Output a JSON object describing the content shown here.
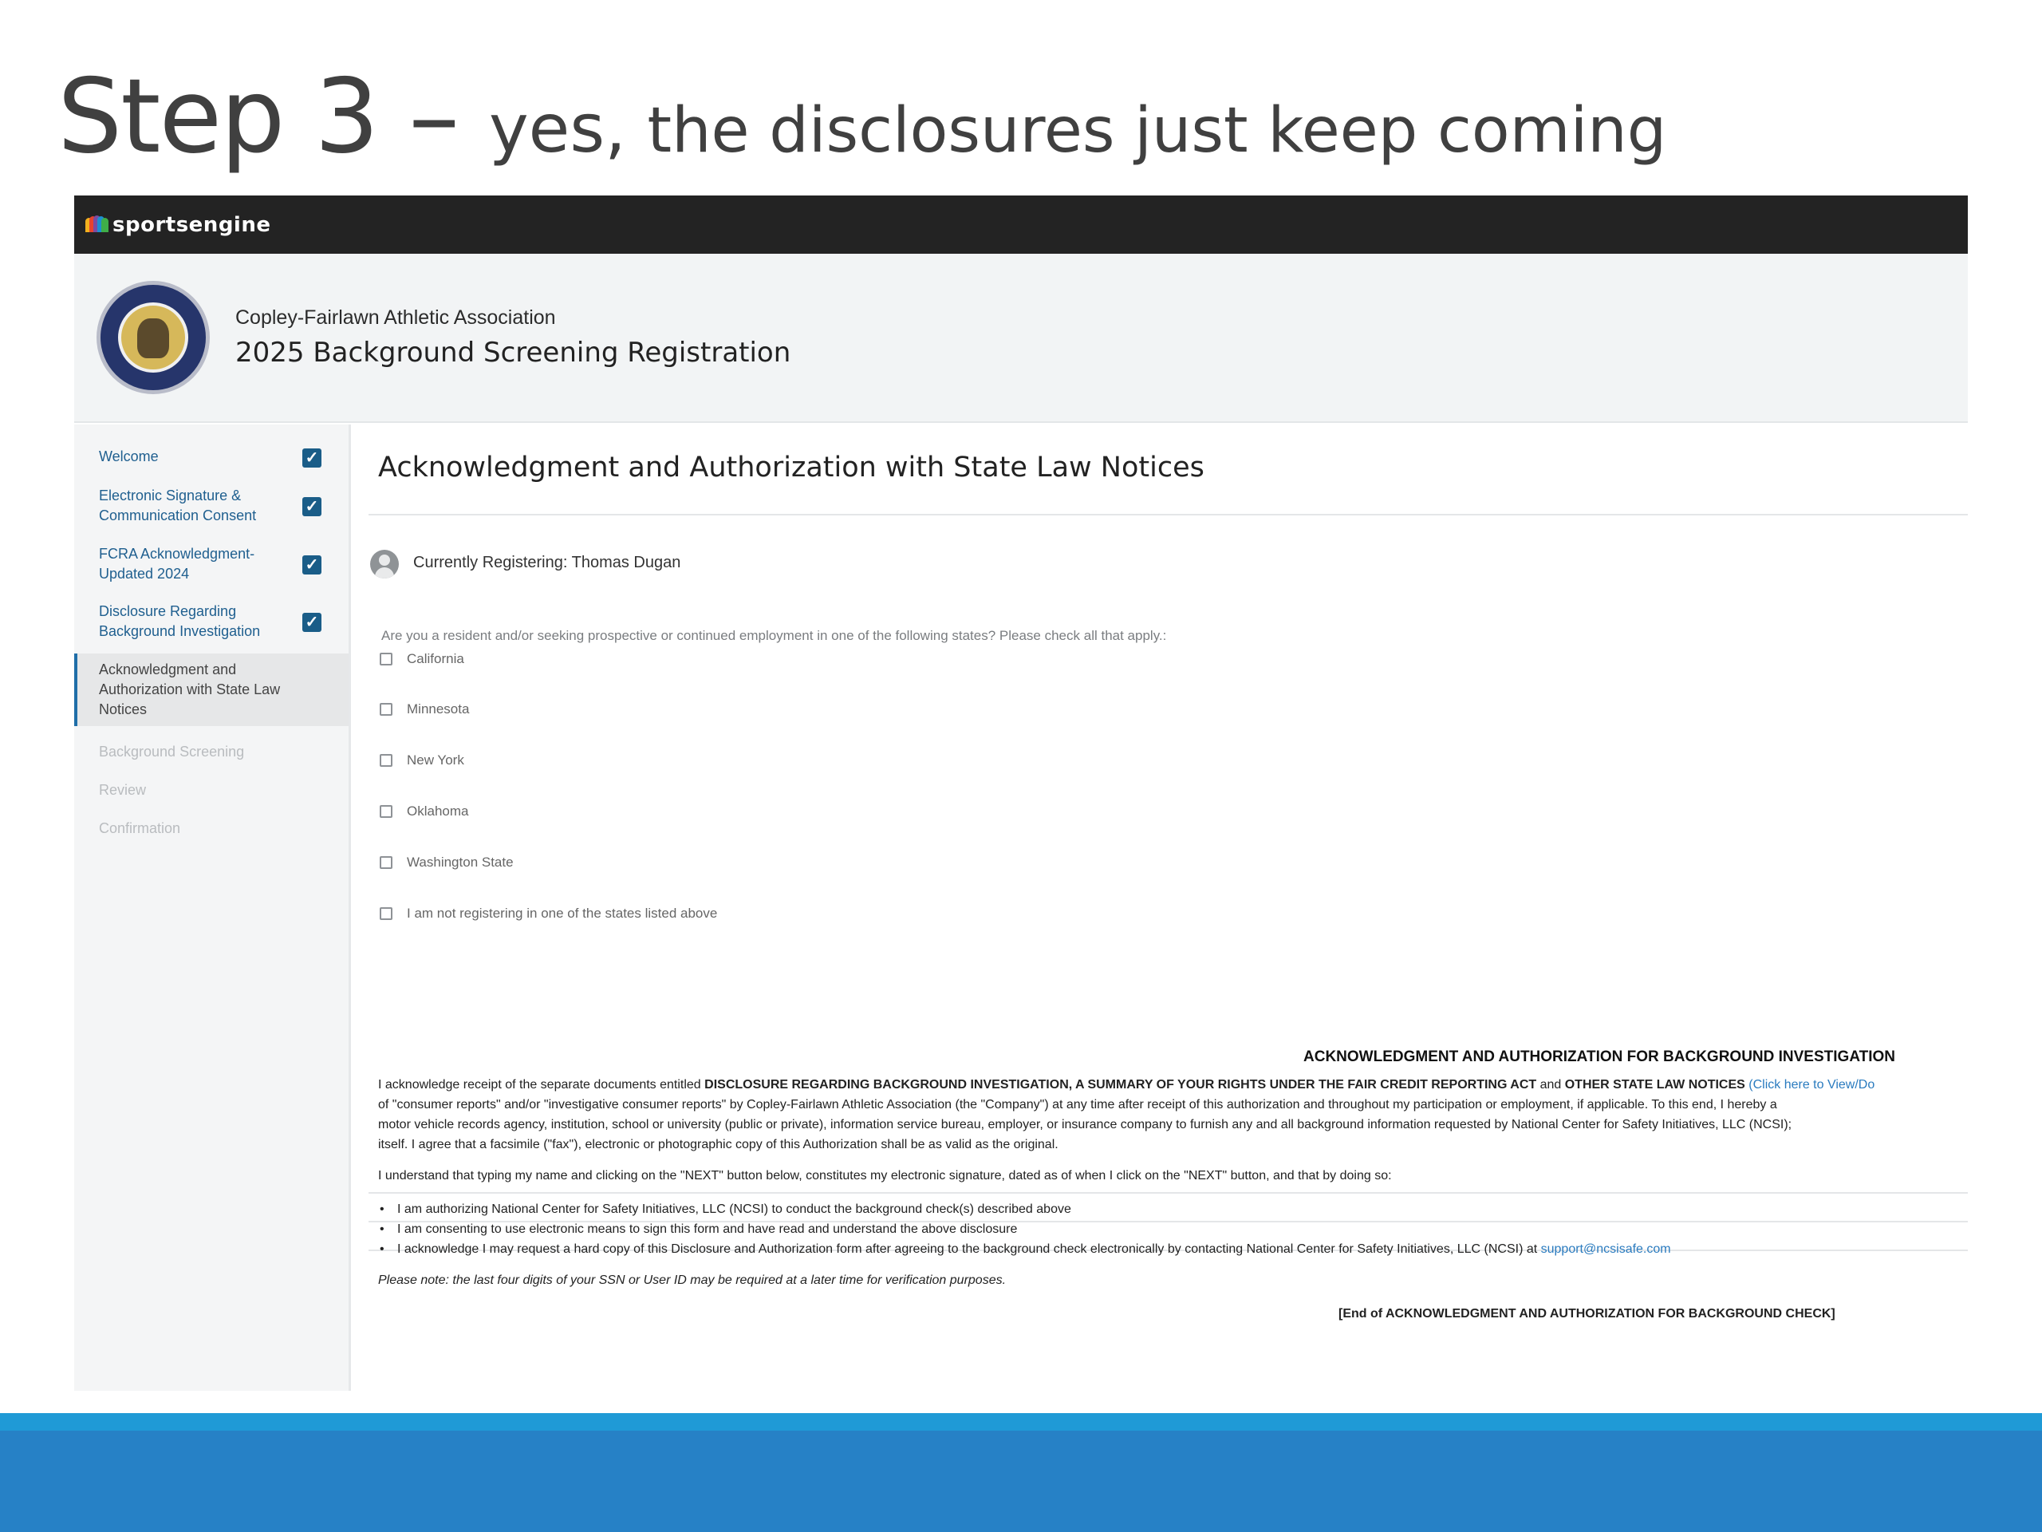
{
  "slide": {
    "title_big": "Step 3 – ",
    "title_mid": "yes, ",
    "title_rest": "the disclosures just keep coming"
  },
  "topbar": {
    "brand": "sportsengine"
  },
  "header": {
    "org_name": "Copley-Fairlawn Athletic Association",
    "registration_title": "2025 Background Screening Registration"
  },
  "sidebar": {
    "items": [
      {
        "line1": "Welcome",
        "line2": "",
        "line3": "",
        "state": "done"
      },
      {
        "line1": "Electronic Signature &",
        "line2": "Communication Consent",
        "line3": "",
        "state": "done"
      },
      {
        "line1": "FCRA Acknowledgment-",
        "line2": "Updated 2024",
        "line3": "",
        "state": "done"
      },
      {
        "line1": "Disclosure Regarding",
        "line2": "Background Investigation",
        "line3": "",
        "state": "done"
      },
      {
        "line1": "Acknowledgment and",
        "line2": "Authorization with State Law",
        "line3": "Notices",
        "state": "active"
      },
      {
        "line1": "Background Screening",
        "line2": "",
        "line3": "",
        "state": "pending"
      },
      {
        "line1": "Review",
        "line2": "",
        "line3": "",
        "state": "pending"
      },
      {
        "line1": "Confirmation",
        "line2": "",
        "line3": "",
        "state": "pending"
      }
    ]
  },
  "main": {
    "heading": "Acknowledgment and Authorization with State Law Notices",
    "registering": "Currently Registering: Thomas Dugan",
    "question": "Are you a resident and/or seeking prospective or continued employment in one of the following states? Please check all that apply.:",
    "options": [
      "California",
      "Minnesota",
      "New York",
      "Oklahoma",
      "Washington State",
      "I am not registering in one of the states listed above"
    ]
  },
  "ack": {
    "title": "ACKNOWLEDGMENT AND AUTHORIZATION FOR BACKGROUND INVESTIGATION",
    "para_line1_a": "I acknowledge receipt of the separate documents entitled ",
    "para_line1_b": "DISCLOSURE REGARDING BACKGROUND INVESTIGATION, A SUMMARY OF YOUR RIGHTS UNDER THE FAIR CREDIT REPORTING ACT",
    "para_line1_c": " and ",
    "para_line1_d": "OTHER STATE LAW NOTICES",
    "para_line1_link": " (Click here to View/Do",
    "para_line2": "of \"consumer reports\" and/or \"investigative consumer reports\" by Copley-Fairlawn Athletic Association  (the \"Company\") at any time after receipt of this authorization and throughout my participation or employment, if applicable. To this end, I hereby a",
    "para_line3": "motor vehicle records agency, institution, school or university (public or private), information service bureau, employer, or insurance company to furnish any and all background information requested by National Center for Safety Initiatives, LLC (NCSI);",
    "para_line4": "itself. I agree that a facsimile (\"fax\"), electronic or photographic copy of this Authorization shall be as valid as the original.",
    "consent": "I understand that typing my name and clicking on the \"NEXT\" button below, constitutes my electronic signature, dated as of when I click on the \"NEXT\" button, and that by doing so:",
    "bullet1": "I am authorizing National Center for Safety Initiatives, LLC (NCSI) to conduct the background check(s) described above",
    "bullet2": "I am consenting to use electronic means to sign this form and have read and understand the above disclosure",
    "bullet3": "I acknowledge I may request a hard copy of this Disclosure and Authorization form after agreeing to the background check electronically by contacting National Center for Safety Initiatives, LLC (NCSI) at ",
    "bullet3_link": "support@ncsisafe.com",
    "note": "Please note: the last four digits of your SSN or User ID may be required at a later time for verification purposes.",
    "end": "[End of ACKNOWLEDGMENT AND AUTHORIZATION FOR BACKGROUND CHECK]"
  },
  "colors": {
    "accent": "#1f6ea8",
    "topbar": "#232323",
    "band_light": "#1f9ad6",
    "band_dark": "#2681c6"
  }
}
